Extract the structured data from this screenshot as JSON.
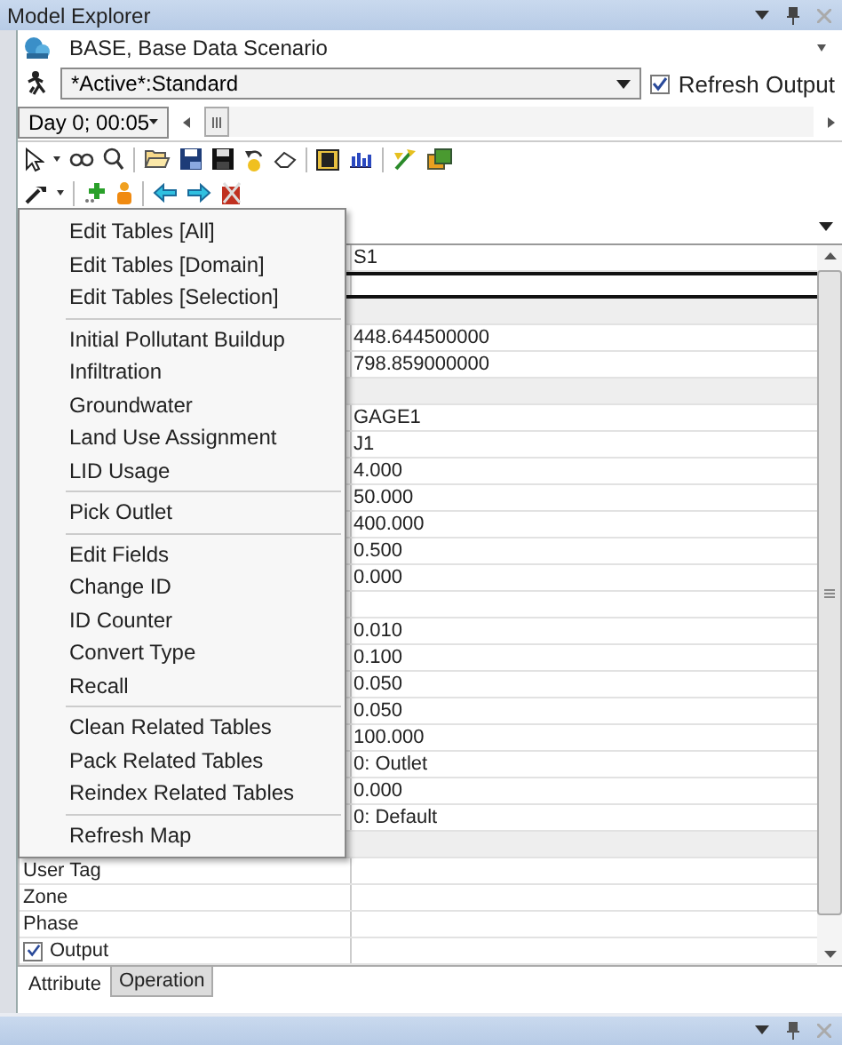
{
  "panel": {
    "title": "Model Explorer"
  },
  "scenario": {
    "value": "BASE, Base Data Scenario"
  },
  "mode": {
    "value": "*Active*:Standard"
  },
  "refresh_output": {
    "label": "Refresh Output",
    "checked": true
  },
  "time": {
    "value": "Day 0; 00:05",
    "level": 0
  },
  "grid": {
    "rows": [
      {
        "kind": "value",
        "value": "S1",
        "selected": false
      },
      {
        "kind": "value",
        "selected": true
      },
      {
        "kind": "group",
        "selected": false
      },
      {
        "kind": "value",
        "value": "448.644500000",
        "selected": false
      },
      {
        "kind": "value",
        "value": "798.859000000",
        "selected": false
      },
      {
        "kind": "group",
        "selected": false
      },
      {
        "kind": "value",
        "value": "GAGE1",
        "selected": false
      },
      {
        "kind": "value",
        "value": "J1",
        "selected": false
      },
      {
        "kind": "value",
        "value": "4.000",
        "selected": false
      },
      {
        "kind": "value",
        "value": "50.000",
        "selected": false
      },
      {
        "kind": "value",
        "value": "400.000",
        "selected": false
      },
      {
        "kind": "value",
        "value": "0.500",
        "selected": false
      },
      {
        "kind": "value",
        "value": "0.000",
        "selected": false
      },
      {
        "kind": "value",
        "selected": false
      },
      {
        "kind": "value",
        "value": "0.010",
        "selected": false
      },
      {
        "kind": "value",
        "value": "0.100",
        "selected": false
      },
      {
        "kind": "value",
        "value": "0.050",
        "selected": false
      },
      {
        "kind": "value",
        "value": "0.050",
        "selected": false
      },
      {
        "kind": "value",
        "value": "100.000",
        "selected": false
      },
      {
        "kind": "value",
        "value": "0: Outlet",
        "selected": false
      },
      {
        "kind": "value",
        "value": "0.000",
        "selected": false
      },
      {
        "kind": "value",
        "value": "0: Default",
        "selected": false
      },
      {
        "kind": "group",
        "selected": false
      },
      {
        "kind": "value",
        "label": "User Tag",
        "selected": false
      },
      {
        "kind": "value",
        "label": "Zone",
        "selected": false
      },
      {
        "kind": "value",
        "label": "Phase",
        "selected": false
      },
      {
        "kind": "check",
        "label": "Output",
        "checked": true,
        "selected": false
      }
    ]
  },
  "context_menu": {
    "groups": [
      [
        "Edit Tables [All]",
        "Edit Tables [Domain]",
        "Edit Tables [Selection]"
      ],
      [
        "Initial Pollutant Buildup",
        "Infiltration",
        "Groundwater",
        "Land Use Assignment",
        "LID Usage"
      ],
      [
        "Pick Outlet"
      ],
      [
        "Edit Fields",
        "Change ID",
        "ID Counter",
        "Convert Type",
        "Recall"
      ],
      [
        "Clean Related Tables",
        "Pack Related Tables",
        "Reindex Related Tables"
      ],
      [
        "Refresh Map"
      ]
    ]
  },
  "tabs": [
    {
      "label": "Attribute",
      "selected": true
    },
    {
      "label": "Operation",
      "selected": false
    }
  ]
}
